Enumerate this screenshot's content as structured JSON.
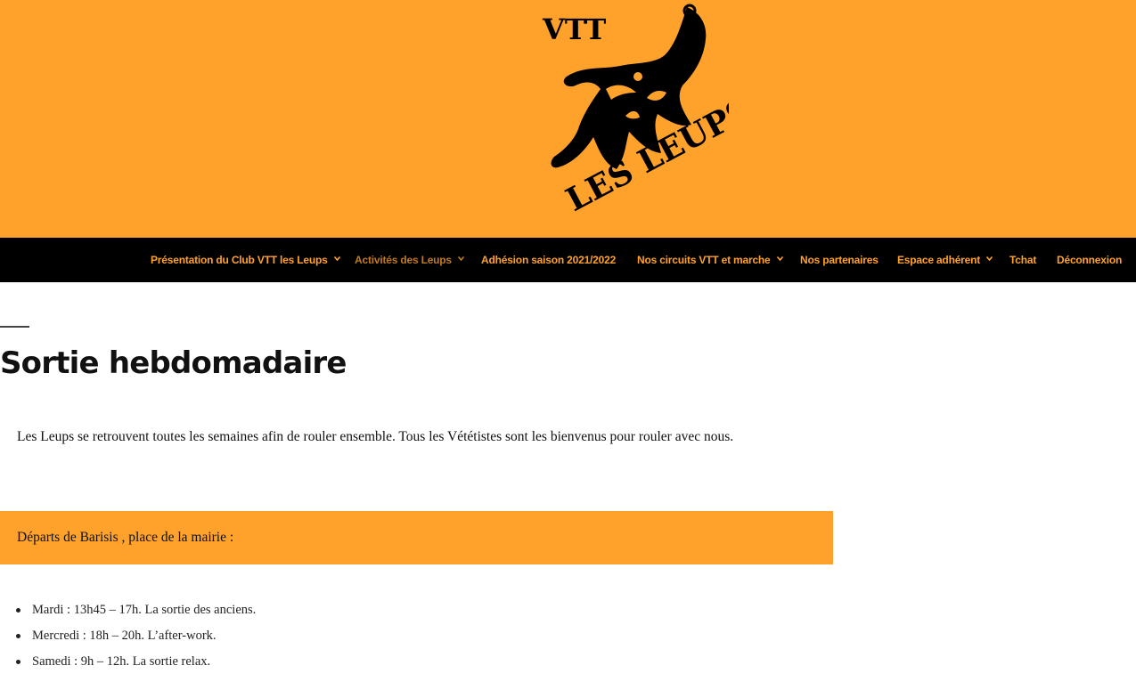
{
  "logo": {
    "icon": "wolf-logo-icon",
    "line1": "VTT",
    "line2": "LES LEUPS"
  },
  "nav": {
    "items": [
      {
        "label": "Présentation du Club VTT les Leups",
        "dropdown": true
      },
      {
        "label": "Activités des Leups",
        "dropdown": true,
        "active": true
      },
      {
        "label": "Adhésion saison 2021/2022",
        "dropdown": false
      },
      {
        "label": "Nos circuits VTT et marche",
        "dropdown": true
      },
      {
        "label": "Nos partenaires",
        "dropdown": false
      },
      {
        "label": "Espace adhérent",
        "dropdown": true
      },
      {
        "label": "Tchat",
        "dropdown": false
      },
      {
        "label": "Déconnexion",
        "dropdown": false
      }
    ]
  },
  "page": {
    "title": "Sortie hebdomadaire",
    "intro": "Les Leups se retrouvent toutes les semaines afin de rouler ensemble. Tous les Vététistes sont les bienvenus pour rouler avec nous.",
    "band_text": "Départs de Barisis , place de la mairie :",
    "schedule": [
      "Mardi : 13h45 – 17h. La sortie des anciens.",
      "Mercredi : 18h – 20h. L’after-work.",
      "Samedi : 9h – 12h. La sortie relax."
    ]
  },
  "colors": {
    "accent": "#ffa22b",
    "nav_bg": "#000000",
    "nav_active": "#c07a22",
    "text": "#111111"
  }
}
